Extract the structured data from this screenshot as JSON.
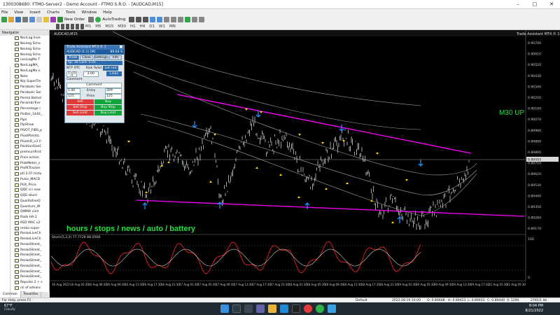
{
  "window": {
    "title": "1300308680: FTMO-Server2 - Demo Account - FTMO S.R.O. - [AUDCAD,M15]"
  },
  "menu": [
    "File",
    "View",
    "Insert",
    "Charts",
    "Tools",
    "Window",
    "Help"
  ],
  "toolbar": {
    "new_order": "New Order",
    "auto_trading": "AutoTrading",
    "timeframes": [
      "M1",
      "M5",
      "M15",
      "M30",
      "H1",
      "H4",
      "D1",
      "W1",
      "MN"
    ]
  },
  "navigator": {
    "title": "Navigator",
    "items": [
      "NonLag Inve",
      "Nonleg Scha",
      "Nonleg Scha",
      "Nonleg Scha",
      "nonLagMa T",
      "NonLagMA_",
      "NonLagMa n",
      "Note",
      "Nip SuperTre",
      "Parabolic Ser",
      "Parabolic Sar",
      "Pentol Batsol",
      "Perambl-Trer",
      "Percentage (",
      "PinBar_1440_",
      "Pips",
      "PipShow",
      "PIVOT_FIBS_p",
      "PivotPointsL",
      "PivotsD_v3 (I",
      "PositionSizeC",
      "premiumfirst",
      "Price action",
      "ProbMeter_v",
      "ProfitTracker",
      "ptl 2.07 histo",
      "Pulse_MACD",
      "PUX_Price",
      "QQE cci new",
      "QQE-stoch",
      "QualitativeQ",
      "Quantum_W",
      "QWMA com",
      "Rads HA-2",
      "RED MAC v2",
      "renko-super",
      "RenkoLiveCh",
      "RenkoLiveCh",
      "RenkoStreet_",
      "RenkoStreet_",
      "RenkoStreet_",
      "RenkoStreet_",
      "RenkoStreet_",
      "RenkoStreet_",
      "RenkoStreet_",
      "Repulse 2 + s",
      "rsi of advanc",
      "RSI - mtf + a",
      "RSI ARROW (",
      "RSI ARROW ("
    ],
    "tabs": [
      "Common",
      "Favorites"
    ]
  },
  "chart": {
    "tab_label": "AUDCAD,M15",
    "assistant_label": "Trade Assistant MT4 © 1",
    "annotation": "M30 UP",
    "overlay_text": "hours / stops / news / auto / battery",
    "indicator_label": "Stoch(5,3,3) 77.7728 88.0568",
    "prices": [
      "0.90700",
      "0.90610",
      "0.90520",
      "0.90430",
      "0.90340",
      "0.90250",
      "0.90160",
      "0.90070",
      "0.89980",
      "0.89890",
      "0.89800",
      "0.89710",
      "0.89620",
      "0.89530",
      "0.89440",
      "0.89350",
      "0.89260",
      "0.89170"
    ],
    "current_price": "0.89593",
    "stoch_scale": [
      "100",
      "0"
    ],
    "dates": [
      "16 Aug 2022",
      "16 Aug 02:30",
      "16 Aug 06:30",
      "16 Aug 09:30",
      "16 Aug 13:30",
      "16 Aug 17:30",
      "16 Aug 21:30",
      "17 Aug 01:30",
      "17 Aug 05:30",
      "17 Aug 09:30",
      "17 Aug 13:30",
      "17 Aug 17:30",
      "17 Aug 21:30",
      "18 Aug 01:30",
      "18 Aug 05:30",
      "18 Aug 09:30",
      "18 Aug 13:30",
      "18 Aug 17:30",
      "18 Aug 21:30",
      "19 Aug 01:30",
      "19 Aug 05:30",
      "19 Aug 09:30",
      "19 Aug 13:30",
      "19 Aug 17:30",
      "22 Aug 01:30",
      "22 Aug 05:30"
    ],
    "colors": {
      "channel": "#ff00ff",
      "arrow_up": "#1e90ff",
      "arrow_small": "#ffd700",
      "text_green": "#22e040",
      "stoch_red": "#d81e1e",
      "ma_gray": "#a8a8a8"
    }
  },
  "trade_assistant": {
    "title": "Trade Assistant MT4 © 1",
    "symbol": "AUDCAD (1:1) [M]",
    "symbol_price": "89.64 S",
    "tabs": [
      "Trade",
      "Close",
      "Settings",
      "Info"
    ],
    "info": "Sp: 16  Com: 5.01",
    "ntp_label": "NTP",
    "rtc_label": "RTC",
    "ntp_value": "1",
    "rtc_value": "0",
    "risk_label": "Risk %/lot",
    "risk_value": "2.00",
    "lot_calc": "Lot calc",
    "lines": "Lines",
    "comment_label": "Comment",
    "comment_value": "Comment",
    "lots_value": "1.00",
    "entry_label": "Entry",
    "entry_value": "209",
    "sl_value": "125",
    "price_label": "Price",
    "price_value": "125",
    "sell": "Sell",
    "buy": "Buy",
    "sell_stop": "Sell Stop",
    "buy_stop": "Buy Stop",
    "sell_limit": "Sell Limit",
    "buy_limit": "Buy Limit"
  },
  "status": {
    "help": "For Help, press F1",
    "profile": "Default",
    "time": "2022.08.19 10:00",
    "o": "O: 0.89488",
    "h": "H: 0.89423",
    "l": "L: 0.89403",
    "c": "C: 0.89440",
    "v": "V: 1290",
    "traffic": "2781/1 kb"
  },
  "taskbar": {
    "temp": "67°F",
    "weather": "Cloudy",
    "time": "8:04 PM",
    "date": "8/21/2022"
  }
}
